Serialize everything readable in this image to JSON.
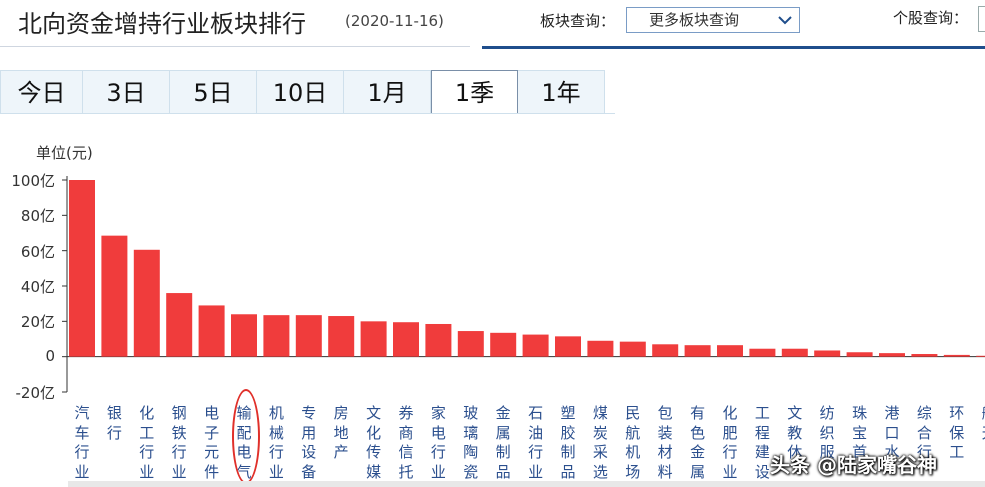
{
  "header": {
    "title": "北向资金增持行业板块排行",
    "date": "(2020-11-16)",
    "sector_query_label": "板块查询：",
    "sector_query_value": "更多板块查询",
    "stock_query_label": "个股查询："
  },
  "tabs": [
    {
      "label": "今日",
      "active": false
    },
    {
      "label": "3日",
      "active": false
    },
    {
      "label": "5日",
      "active": false
    },
    {
      "label": "10日",
      "active": false
    },
    {
      "label": "1月",
      "active": false
    },
    {
      "label": "1季",
      "active": true
    },
    {
      "label": "1年",
      "active": false
    }
  ],
  "watermark": "头条 @陆家嘴谷神",
  "chart_data": {
    "type": "bar",
    "unit_label": "单位(元)",
    "y_ticks": [
      "100亿",
      "80亿",
      "60亿",
      "40亿",
      "20亿",
      "0",
      "-20亿"
    ],
    "ylim": [
      -20,
      100
    ],
    "bar_color": "#f03c3c",
    "highlight_circle_color": "#e0302a",
    "categories": [
      "汽车行业",
      "银行",
      "化工行业",
      "钢铁行业",
      "电子元件",
      "输配电气",
      "机械行业",
      "专用设备",
      "房地产",
      "文化传媒",
      "券商信托",
      "家电行业",
      "玻璃陶瓷",
      "金属制品",
      "石油行业",
      "塑胶制品",
      "煤炭采选",
      "民航机场",
      "包装材料",
      "有色金属",
      "化肥行业",
      "工程建设",
      "文教休",
      "纺织服",
      "珠宝首",
      "港口水",
      "综合行",
      "环保工",
      "航天"
    ],
    "values": [
      100,
      68.5,
      60.5,
      36,
      29,
      24,
      23.5,
      23.5,
      23,
      20,
      19.5,
      18.5,
      14.5,
      13.5,
      12.5,
      11.5,
      9,
      8.5,
      7,
      6.5,
      6.5,
      4.5,
      4.5,
      3.5,
      2.5,
      2,
      1.5,
      1,
      0.5
    ],
    "highlighted_category": "输配电气"
  }
}
